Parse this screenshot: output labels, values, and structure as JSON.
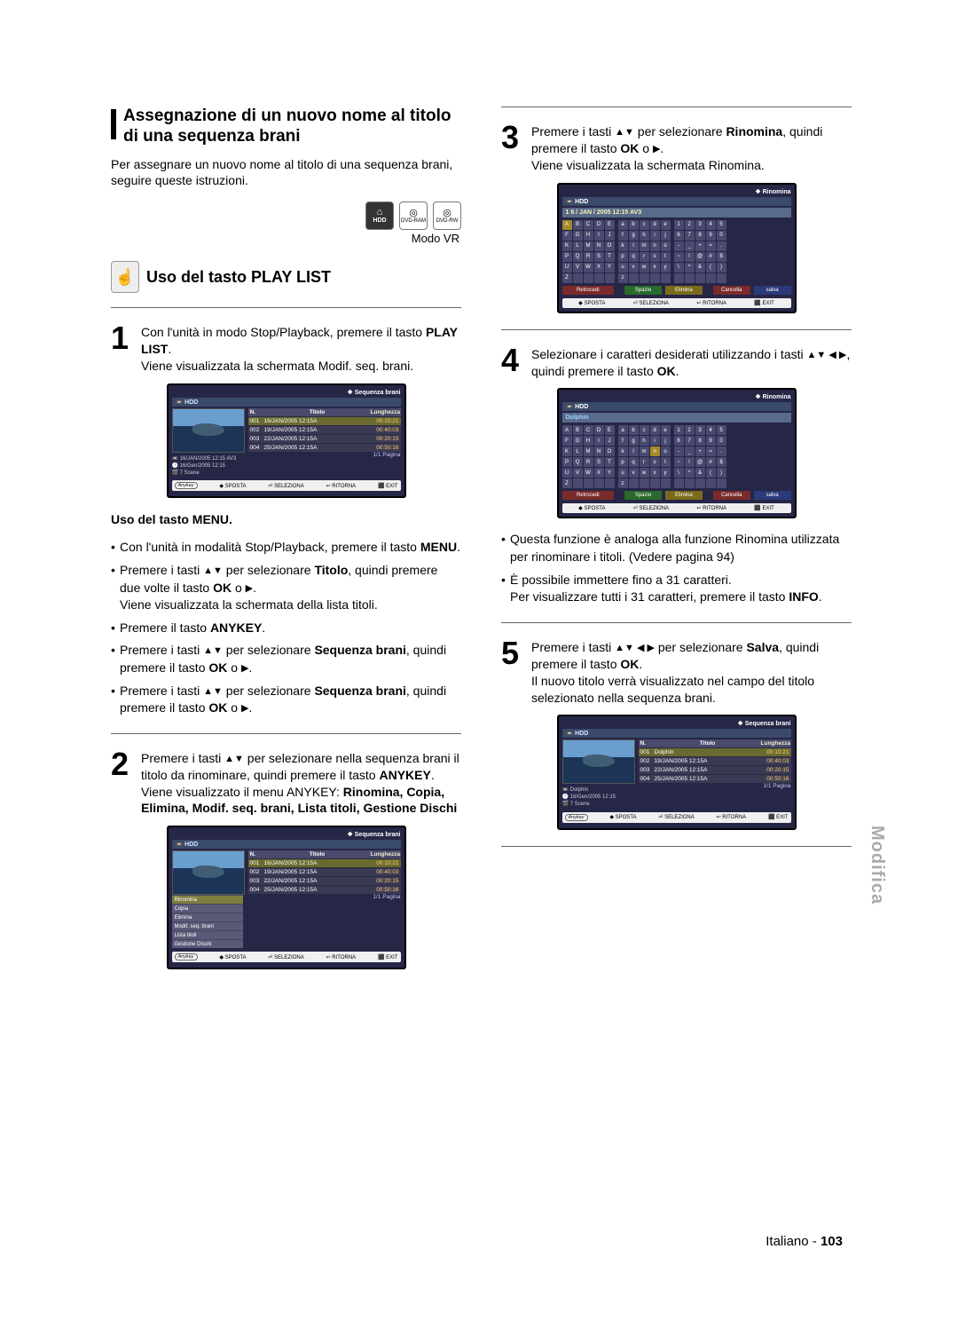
{
  "section_title": "Assegnazione di un nuovo nome al titolo di una sequenza brani",
  "intro": "Per assegnare un nuovo nome al titolo di una sequenza brani, seguire queste istruzioni.",
  "disc_labels": {
    "hdd": "HDD",
    "ram": "DVD-RAM",
    "rw": "DVD-RW"
  },
  "mode": "Modo VR",
  "sub_heading": "Uso del tasto PLAY LIST",
  "step1": {
    "line1": "Con l'unità in modo Stop/Playback, premere il tasto ",
    "pl": "PLAY LIST",
    "line2": "Viene visualizzata la schermata Modif. seq. brani."
  },
  "menu_heading": "Uso del tasto MENU.",
  "menu_bullets": {
    "b1a": "Con l'unità in modalità Stop/Playback, premere il tasto ",
    "b1b": "MENU",
    "b2a": "Premere i tasti ",
    "b2b": " per selezionare ",
    "b2c": "Titolo",
    "b2d": ", quindi premere due volte il tasto ",
    "b2e": "OK",
    "b2f": " o ",
    "b2g": "Viene visualizzata la schermata della lista titoli.",
    "b3a": "Premere il tasto ",
    "b3b": "ANYKEY",
    "b4a": "Premere i tasti ",
    "b4b": " per selezionare ",
    "b4c": "Sequenza brani",
    "b4d": ", quindi premere il tasto ",
    "b4e": "OK",
    "b4f": " o "
  },
  "step2": {
    "l1": "Premere i tasti ",
    "l2": " per selezionare nella sequenza brani il titolo da rinominare, quindi premere il tasto ",
    "anykey": "ANYKEY",
    "l3": "Viene visualizzato il menu ANYKEY: ",
    "menus": "Rinomina, Copia, Elimina, Modif. seq. brani, Lista titoli, Gestione Dischi"
  },
  "step3": {
    "l1": "Premere i tasti ",
    "l2": " per selezionare ",
    "rin": "Rinomina",
    "l3": ", quindi premere il tasto ",
    "ok": "OK",
    "l4": " o ",
    "l5": "Viene visualizzata la schermata Rinomina."
  },
  "step4": {
    "l1": "Selezionare i caratteri desiderati utilizzando i tasti ",
    "l2": ", quindi premere il tasto ",
    "ok": "OK"
  },
  "note1": "Questa funzione è analoga alla funzione Rinomina utilizzata per rinominare i titoli. (Vedere pagina 94)",
  "note2a": "È possibile immettere fino a 31 caratteri.",
  "note2b": "Per visualizzare tutti i 31 caratteri, premere il tasto ",
  "info": "INFO",
  "step5": {
    "l1": "Premere i tasti ",
    "l2": " per selezionare ",
    "salva": "Salva",
    "l3": ", quindi premere il tasto ",
    "ok": "OK",
    "l4": "Il nuovo titolo verrà visualizzato nel campo del titolo selezionato nella sequenza brani."
  },
  "screen_list": {
    "title": "Sequenza brani",
    "hdd": "HDD",
    "cols": {
      "n": "N.",
      "titolo": "Titolo",
      "len": "Lunghezza"
    },
    "rows": [
      {
        "n": "001",
        "t": "16/JAN/2005 12:15A",
        "l": "00:10:21"
      },
      {
        "n": "002",
        "t": "19/JAN/2005 12:15A",
        "l": "00:40:03"
      },
      {
        "n": "003",
        "t": "22/JAN/2005 12:15A",
        "l": "00:20:15"
      },
      {
        "n": "004",
        "t": "25/JAN/2005 12:15A",
        "l": "00:50:16"
      }
    ],
    "meta1": "16/JAN/2005 12:15 AV3",
    "meta2": "16/Gen/2005 12:15",
    "meta3": "7 Scene",
    "pager": "1/1 Pagina",
    "footer": {
      "any": "Anykey",
      "sposta": "SPOSTA",
      "sel": "SELEZIONA",
      "rit": "RITORNA",
      "exit": "EXIT"
    }
  },
  "screen_ctx": {
    "title": "Sequenza brani",
    "menu": [
      "Rinomina",
      "Copia",
      "Elimina",
      "Modif. seq. brani",
      "Lista titoli",
      "Gestione Dischi"
    ]
  },
  "screen_kb1": {
    "title": "Rinomina",
    "hdd": "HDD",
    "input": "1 6 / JAN / 2005 12:15 AV3",
    "actions": {
      "retro": "Retrocedi",
      "spazio": "Spazio",
      "elimina": "Elimina",
      "cancella": "Cancella",
      "salva": "salva"
    },
    "footer": {
      "sposta": "SPOSTA",
      "sel": "SELEZIONA",
      "rit": "RITORNA",
      "exit": "EXIT"
    }
  },
  "screen_kb2": {
    "title": "Rinomina",
    "hdd": "HDD",
    "input": "Dolphin"
  },
  "screen_final": {
    "title": "Sequenza brani",
    "row1": {
      "n": "001",
      "t": "Dolphin",
      "l": "00:10:21"
    },
    "meta1": "Dolphin",
    "meta2": "16/Gen/2005 12:15",
    "meta3": "7 Scene"
  },
  "kb_upper": [
    "A",
    "B",
    "C",
    "D",
    "E",
    "F",
    "G",
    "H",
    "I",
    "J",
    "K",
    "L",
    "M",
    "N",
    "O",
    "P",
    "Q",
    "R",
    "S",
    "T",
    "U",
    "V",
    "W",
    "X",
    "Y",
    "Z",
    " ",
    " ",
    " ",
    " "
  ],
  "kb_lower": [
    "a",
    "b",
    "c",
    "d",
    "e",
    "f",
    "g",
    "h",
    "i",
    "j",
    "k",
    "l",
    "m",
    "n",
    "o",
    "p",
    "q",
    "r",
    "s",
    "t",
    "u",
    "v",
    "w",
    "x",
    "y",
    "z",
    " ",
    " ",
    " ",
    " "
  ],
  "kb_sym": [
    "1",
    "2",
    "3",
    "4",
    "5",
    "6",
    "7",
    "8",
    "9",
    "0",
    "-",
    "_",
    "+",
    "=",
    ".",
    "~",
    "!",
    "@",
    "#",
    "$",
    "\\",
    "^",
    "&",
    "(",
    ")",
    " ",
    " ",
    " ",
    " ",
    " "
  ],
  "side_tab": "Modifica",
  "page_lang": "Italiano",
  "page_no": "103"
}
